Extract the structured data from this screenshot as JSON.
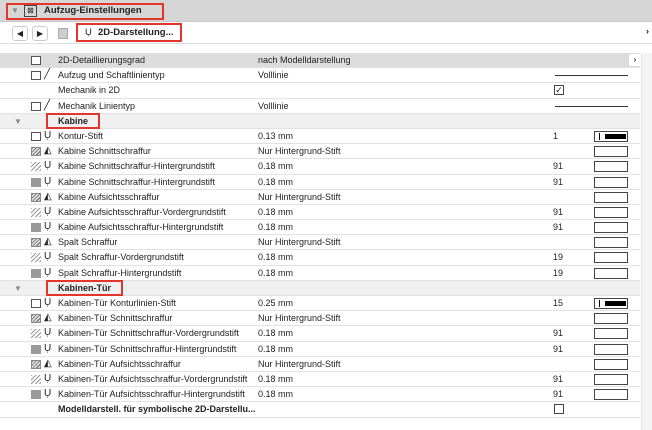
{
  "title": "Aufzug-Einstellungen",
  "nav": {
    "back": "◀",
    "forward": "▶",
    "panel": "2D-Darstellung...",
    "more": "›"
  },
  "rows": [
    {
      "type": "first",
      "i1": "box",
      "label": "2D-Detaillierungsgrad",
      "value": "nach Modelldarstellung",
      "right": "arrow"
    },
    {
      "i1": "box",
      "i2": "line",
      "label": "Aufzug und Schaftlinientyp",
      "value": "Volllinie",
      "right": "line"
    },
    {
      "label": "Mechanik in 2D",
      "right": "check",
      "checked": true
    },
    {
      "i1": "box",
      "i2": "line",
      "label": "Mechanik Linientyp",
      "value": "Volllinie",
      "right": "line"
    },
    {
      "type": "group",
      "label": "Kabine"
    },
    {
      "i1": "box",
      "i2": "pen",
      "label": "Kontur-Stift",
      "value": "0.13 mm",
      "num": "1",
      "right": "pen"
    },
    {
      "i1": "hatch",
      "i2": "fill",
      "label": "Kabine Schnittschraffur",
      "value": "Nur Hintergrund-Stift",
      "right": "sw"
    },
    {
      "i1": "lhatch",
      "i2": "pen",
      "label": "Kabine Schnittschraffur-Hintergrundstift",
      "value": "0.18 mm",
      "num": "91",
      "right": "sw"
    },
    {
      "i1": "gray",
      "i2": "pen",
      "label": "Kabine Schnittschraffur-Hintergrundstift",
      "value": "0.18 mm",
      "num": "91",
      "right": "sw"
    },
    {
      "i1": "hatch",
      "i2": "fill",
      "label": "Kabine Aufsichtsschraffur",
      "value": "Nur Hintergrund-Stift",
      "right": "sw"
    },
    {
      "i1": "lhatch",
      "i2": "pen",
      "label": "Kabine Aufsichtsschraffur-Vordergrundstift",
      "value": "0.18 mm",
      "num": "91",
      "right": "sw"
    },
    {
      "i1": "gray",
      "i2": "pen",
      "label": "Kabine Aufsichtsschraffur-Hintergrundstift",
      "value": "0.18 mm",
      "num": "91",
      "right": "sw"
    },
    {
      "i1": "hatch",
      "i2": "fill",
      "label": "Spalt Schraffur",
      "value": "Nur Hintergrund-Stift",
      "right": "sw"
    },
    {
      "i1": "lhatch",
      "i2": "pen",
      "label": "Spalt Schraffur-Vordergrundstift",
      "value": "0.18 mm",
      "num": "19",
      "right": "sw"
    },
    {
      "i1": "gray",
      "i2": "pen",
      "label": "Spalt Schraffur-Hintergrundstift",
      "value": "0.18 mm",
      "num": "19",
      "right": "sw"
    },
    {
      "type": "group",
      "label": "Kabinen-Tür"
    },
    {
      "i1": "box",
      "i2": "pen",
      "label": "Kabinen-Tür Konturlinien-Stift",
      "value": "0.25 mm",
      "num": "15",
      "right": "pen"
    },
    {
      "i1": "hatch",
      "i2": "fill",
      "label": "Kabinen-Tür Schnittschraffur",
      "value": "Nur Hintergrund-Stift",
      "right": "sw"
    },
    {
      "i1": "lhatch",
      "i2": "pen",
      "label": "Kabinen-Tür Schnittschraffur-Vordergrundstift",
      "value": "0.18 mm",
      "num": "91",
      "right": "sw"
    },
    {
      "i1": "gray",
      "i2": "pen",
      "label": "Kabinen-Tür  Schnittschraffur-Hintergrundstift",
      "value": "0.18 mm",
      "num": "91",
      "right": "sw"
    },
    {
      "i1": "hatch",
      "i2": "fill",
      "label": "Kabinen-Tür Aufsichtsschraffur",
      "value": "Nur Hintergrund-Stift",
      "right": "sw"
    },
    {
      "i1": "lhatch",
      "i2": "pen",
      "label": "Kabinen-Tür Aufsichtsschraffur-Vordergrundstift",
      "value": "0.18 mm",
      "num": "91",
      "right": "sw"
    },
    {
      "i1": "gray",
      "i2": "pen",
      "label": "Kabinen-Tür Aufsichtsschraffur-Hintergrundstift",
      "value": "0.18 mm",
      "num": "91",
      "right": "sw"
    },
    {
      "type": "bold",
      "label": "Modelldarstell. für symbolische 2D-Darstellu...",
      "right": "check",
      "checked": false
    }
  ]
}
